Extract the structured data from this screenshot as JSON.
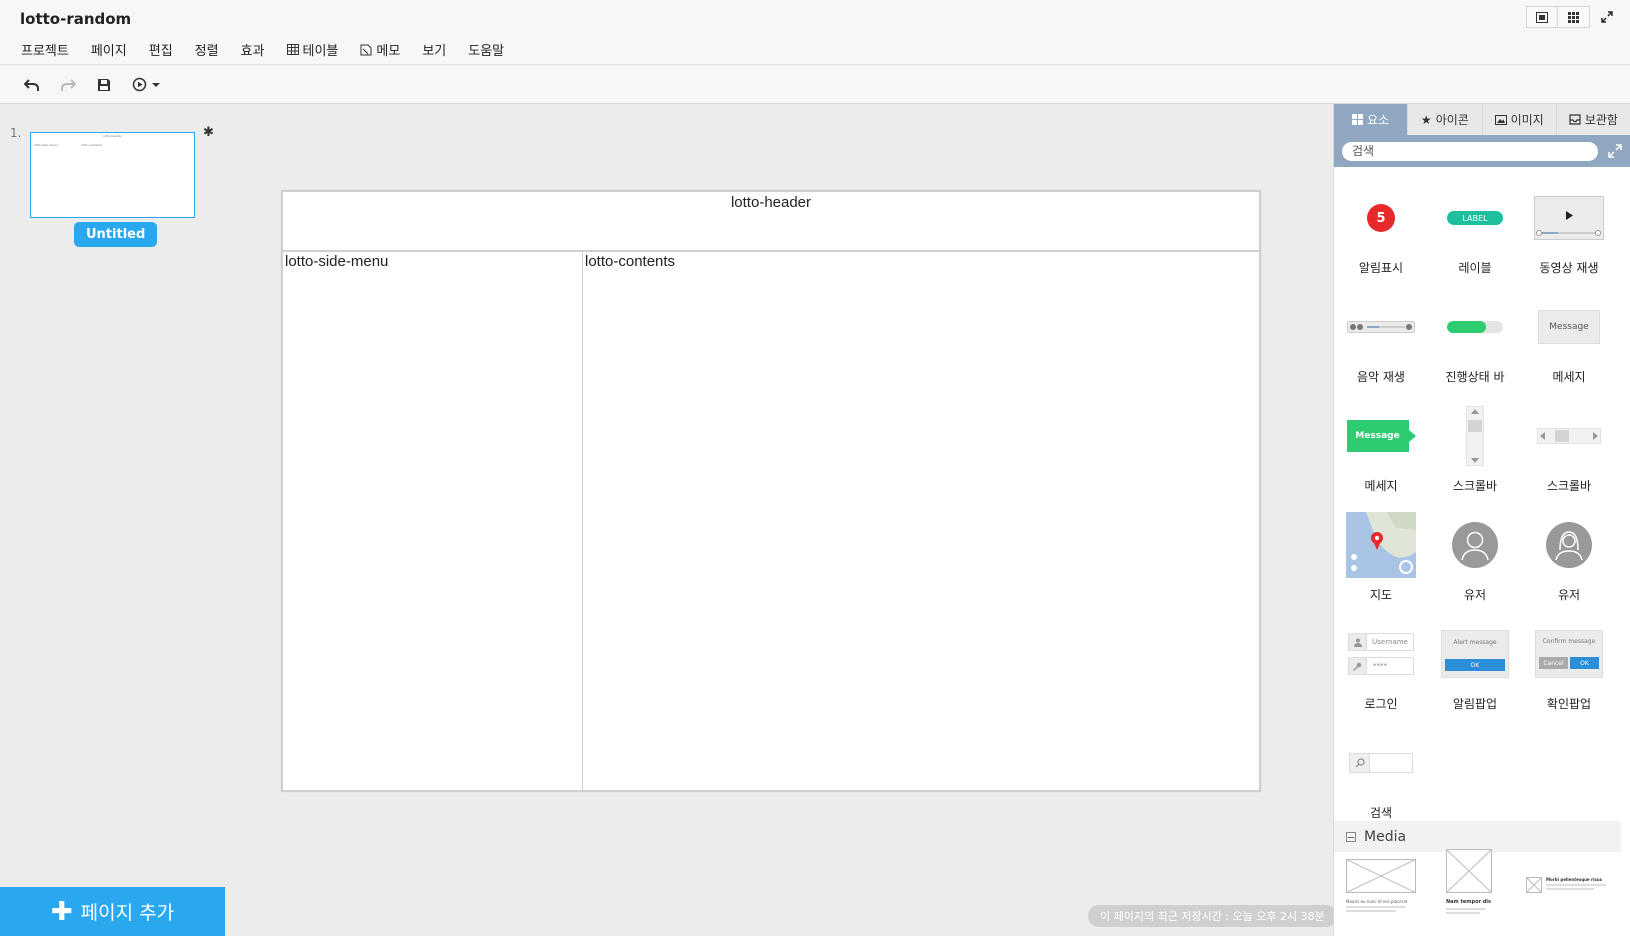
{
  "app": {
    "title": "lotto-random"
  },
  "menu": [
    {
      "label": "프로젝트",
      "icon": ""
    },
    {
      "label": "페이지",
      "icon": ""
    },
    {
      "label": "편집",
      "icon": ""
    },
    {
      "label": "정렬",
      "icon": ""
    },
    {
      "label": "효과",
      "icon": ""
    },
    {
      "label": "테이블",
      "icon": "table-icon"
    },
    {
      "label": "메모",
      "icon": "memo-icon"
    },
    {
      "label": "보기",
      "icon": ""
    },
    {
      "label": "도움말",
      "icon": ""
    }
  ],
  "toolbar": {
    "icons": [
      "undo-icon",
      "redo-icon",
      "save-icon",
      "play-icon",
      "caret-down-icon"
    ]
  },
  "pages": [
    {
      "number": "1.",
      "name": "Untitled"
    }
  ],
  "canvas": {
    "header": "lotto-header",
    "side_menu": "lotto-side-menu",
    "contents": "lotto-contents"
  },
  "add_page": {
    "label": "페이지 추가"
  },
  "status": {
    "save_text": "이 페이지의 최근 저장시간 : 오늘 오후 2시 38분"
  },
  "panel": {
    "tabs": [
      {
        "label": "요소",
        "icon": "grid-icon",
        "active": true
      },
      {
        "label": "아이콘",
        "icon": "star-icon",
        "active": false
      },
      {
        "label": "이미지",
        "icon": "image-icon",
        "active": false
      },
      {
        "label": "보관함",
        "icon": "archive-icon",
        "active": false
      }
    ],
    "search_placeholder": "검색",
    "elements": [
      {
        "label": "알림표시",
        "badge": "5"
      },
      {
        "label": "레이블",
        "text": "LABEL"
      },
      {
        "label": "동영상 재생"
      },
      {
        "label": "음악 재생"
      },
      {
        "label": "진행상태 바"
      },
      {
        "label": "메세지",
        "text": "Message"
      },
      {
        "label": "메세지",
        "text": "Message"
      },
      {
        "label": "스크롤바"
      },
      {
        "label": "스크롤바"
      },
      {
        "label": "지도"
      },
      {
        "label": "유저"
      },
      {
        "label": "유저"
      },
      {
        "label": "로그인",
        "username": "Username",
        "password": "****"
      },
      {
        "label": "알림팝업",
        "message": "Alert message",
        "ok": "OK"
      },
      {
        "label": "확인팝업",
        "message": "Confirm message",
        "cancel": "Cancel",
        "ok": "OK"
      },
      {
        "label": "검색"
      }
    ],
    "media_section": {
      "label": "Media"
    },
    "media_items": [
      {
        "title": "Mauris eu nunc id nisi placerat"
      },
      {
        "title": "Nam tempor dis"
      },
      {
        "title": "Morbi pellentesque risus"
      }
    ],
    "colors": {
      "accent": "#2aa8ef",
      "panel_header": "#8fa7c0",
      "badge_red": "#e8282a",
      "label_green": "#1ebf9c",
      "progress_green": "#2ecc71"
    }
  }
}
